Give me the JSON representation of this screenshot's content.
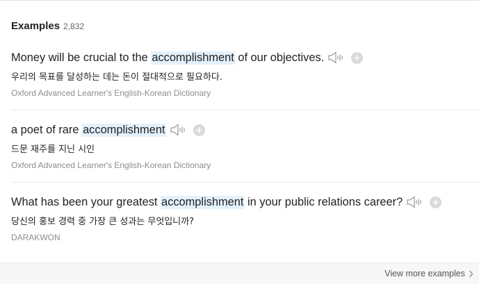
{
  "section": {
    "title": "Examples",
    "count": "2,832"
  },
  "examples": [
    {
      "before": "Money will be crucial to the ",
      "highlight": "accomplishment",
      "after": " of our objectives.",
      "translation": "우리의 목표를 달성하는 데는 돈이 절대적으로 필요하다.",
      "source": "Oxford Advanced Learner's English-Korean Dictionary"
    },
    {
      "before": "a poet of rare ",
      "highlight": "accomplishment",
      "after": "",
      "translation": "드문 재주를 지닌 시인",
      "source": "Oxford Advanced Learner's English-Korean Dictionary"
    },
    {
      "before": "What has been your greatest ",
      "highlight": "accomplishment",
      "after": " in your public relations career?",
      "translation": "당신의 홍보 경력 중 가장 큰 성과는 무엇입니까?",
      "source": "DARAKWON"
    }
  ],
  "footer": {
    "more_label": "View more examples"
  },
  "icons": {
    "speaker": "speaker-icon",
    "add": "plus-circle-icon",
    "more": "chevron-right-icon"
  },
  "colors": {
    "highlight": "#e3f1fc",
    "icon": "#9a9a9a",
    "add_circle": "#d9d9d9",
    "source_text": "#8c8c8c"
  }
}
